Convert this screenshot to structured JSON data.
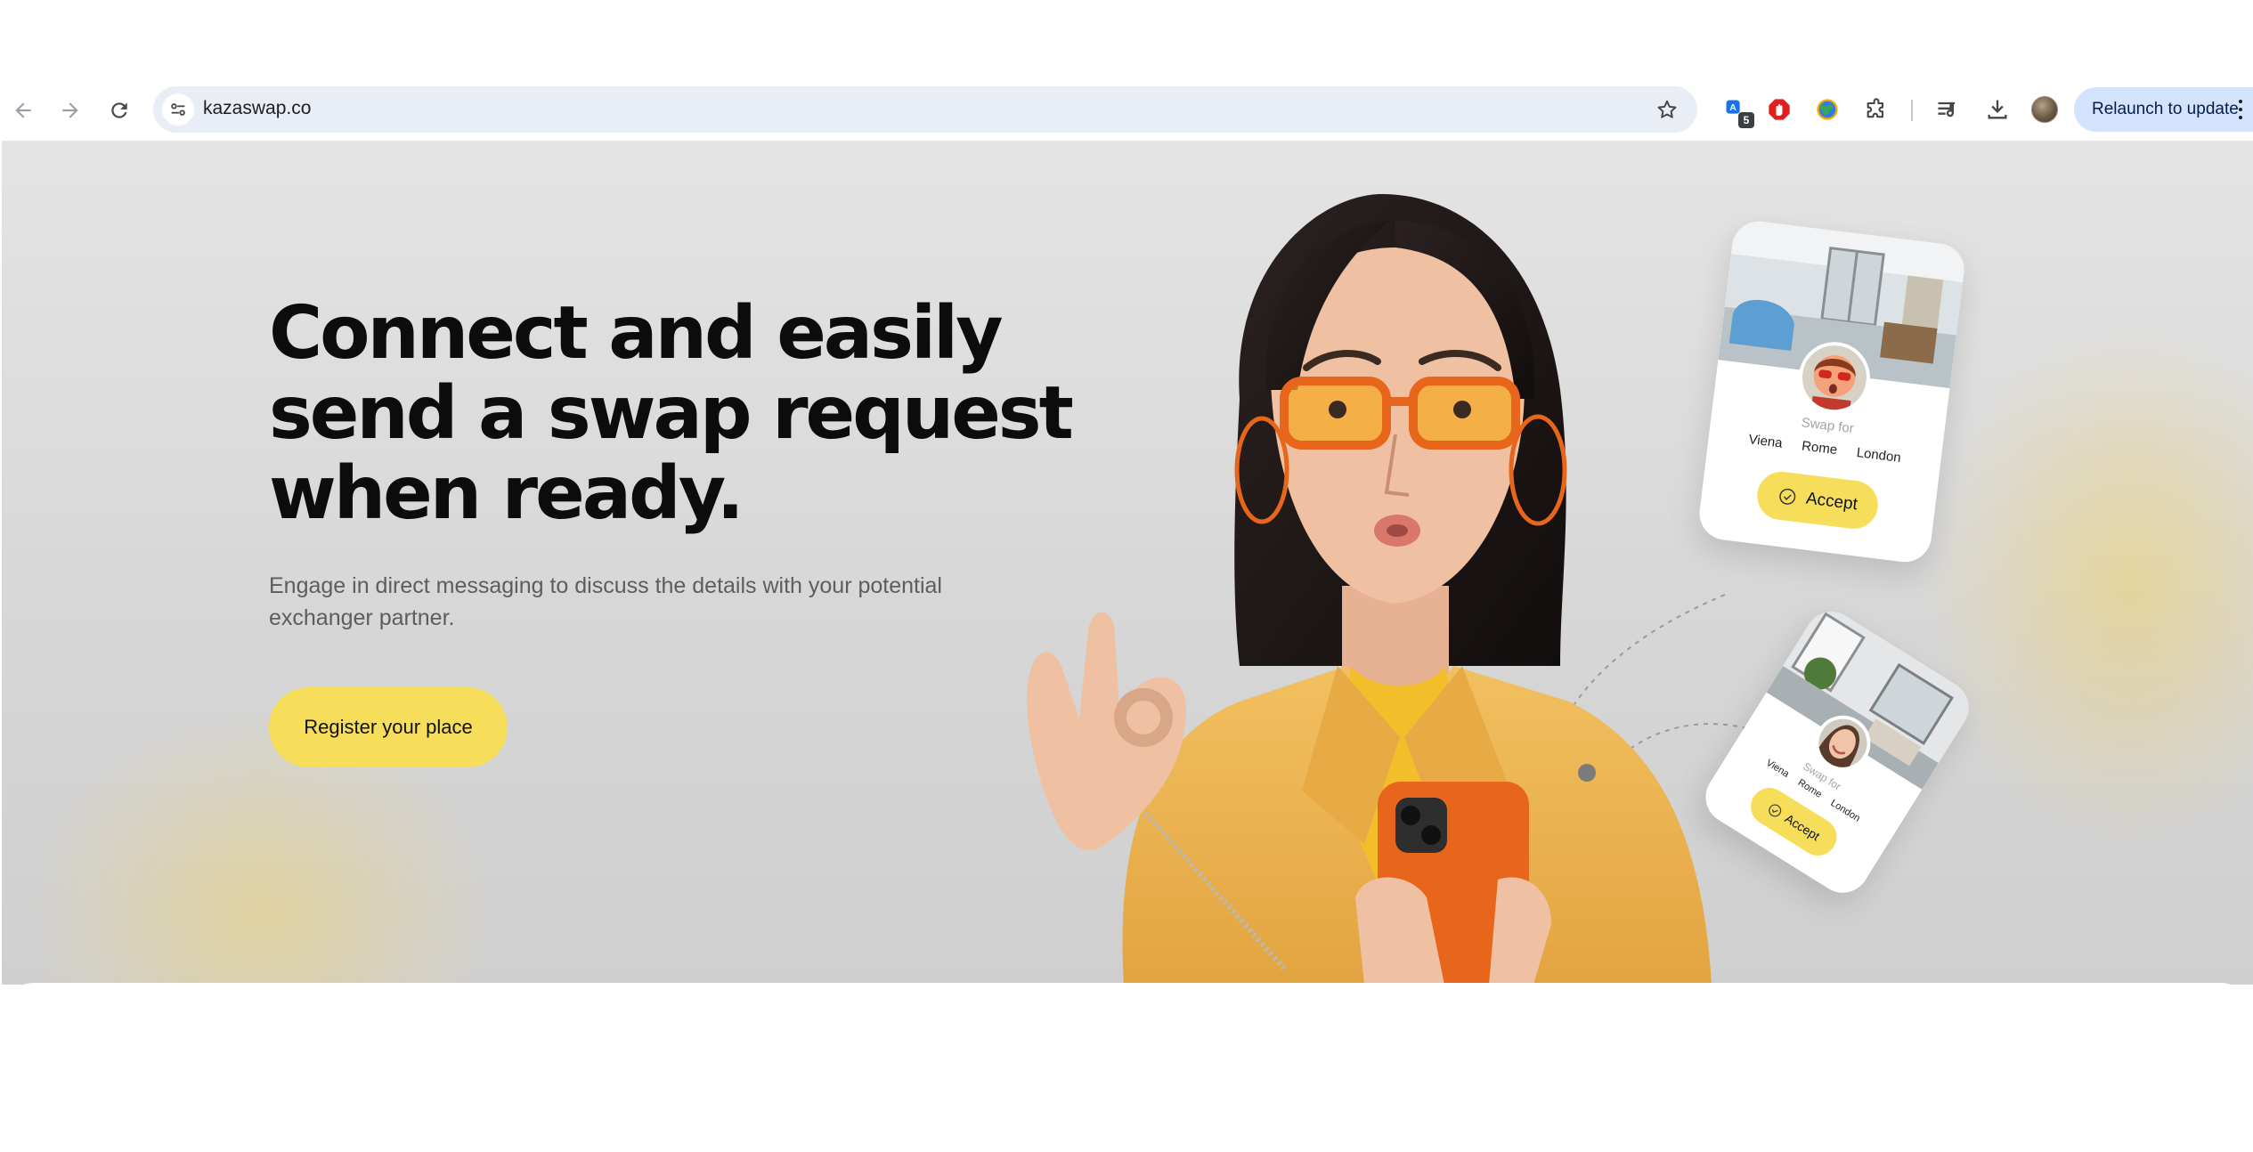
{
  "browser": {
    "url": "kazaswap.co",
    "relaunch_label": "Relaunch to update",
    "extension_badge": "5",
    "icons": {
      "back": "back-arrow-icon",
      "forward": "forward-arrow-icon",
      "reload": "reload-icon",
      "site_info": "tune-icon",
      "bookmark": "star-icon",
      "extensions": [
        "translate-extension-icon",
        "adblock-extension-icon",
        "globe-extension-icon",
        "puzzle-extensions-icon",
        "media-controls-icon",
        "download-icon"
      ],
      "menu": "kebab-menu-icon"
    }
  },
  "hero": {
    "headline": [
      "Connect and easily",
      "send a swap request",
      "when ready."
    ],
    "subtext": "Engage in direct messaging to discuss the details with your potential exchanger partner.",
    "cta_label": "Register your place"
  },
  "cards": [
    {
      "swap_for": "Swap for",
      "cities": [
        "Viena",
        "Rome",
        "London"
      ],
      "accept_label": "Accept"
    },
    {
      "swap_for": "Swap for",
      "cities": [
        "Viena",
        "Rome",
        "London"
      ],
      "accept_label": "Accept"
    }
  ],
  "colors": {
    "accent_yellow": "#f7de5a",
    "chrome_blue": "#d3e3fd",
    "omnibox": "#e9eef6",
    "heading": "#0c0c0c",
    "body_text": "#5d5d5d"
  }
}
